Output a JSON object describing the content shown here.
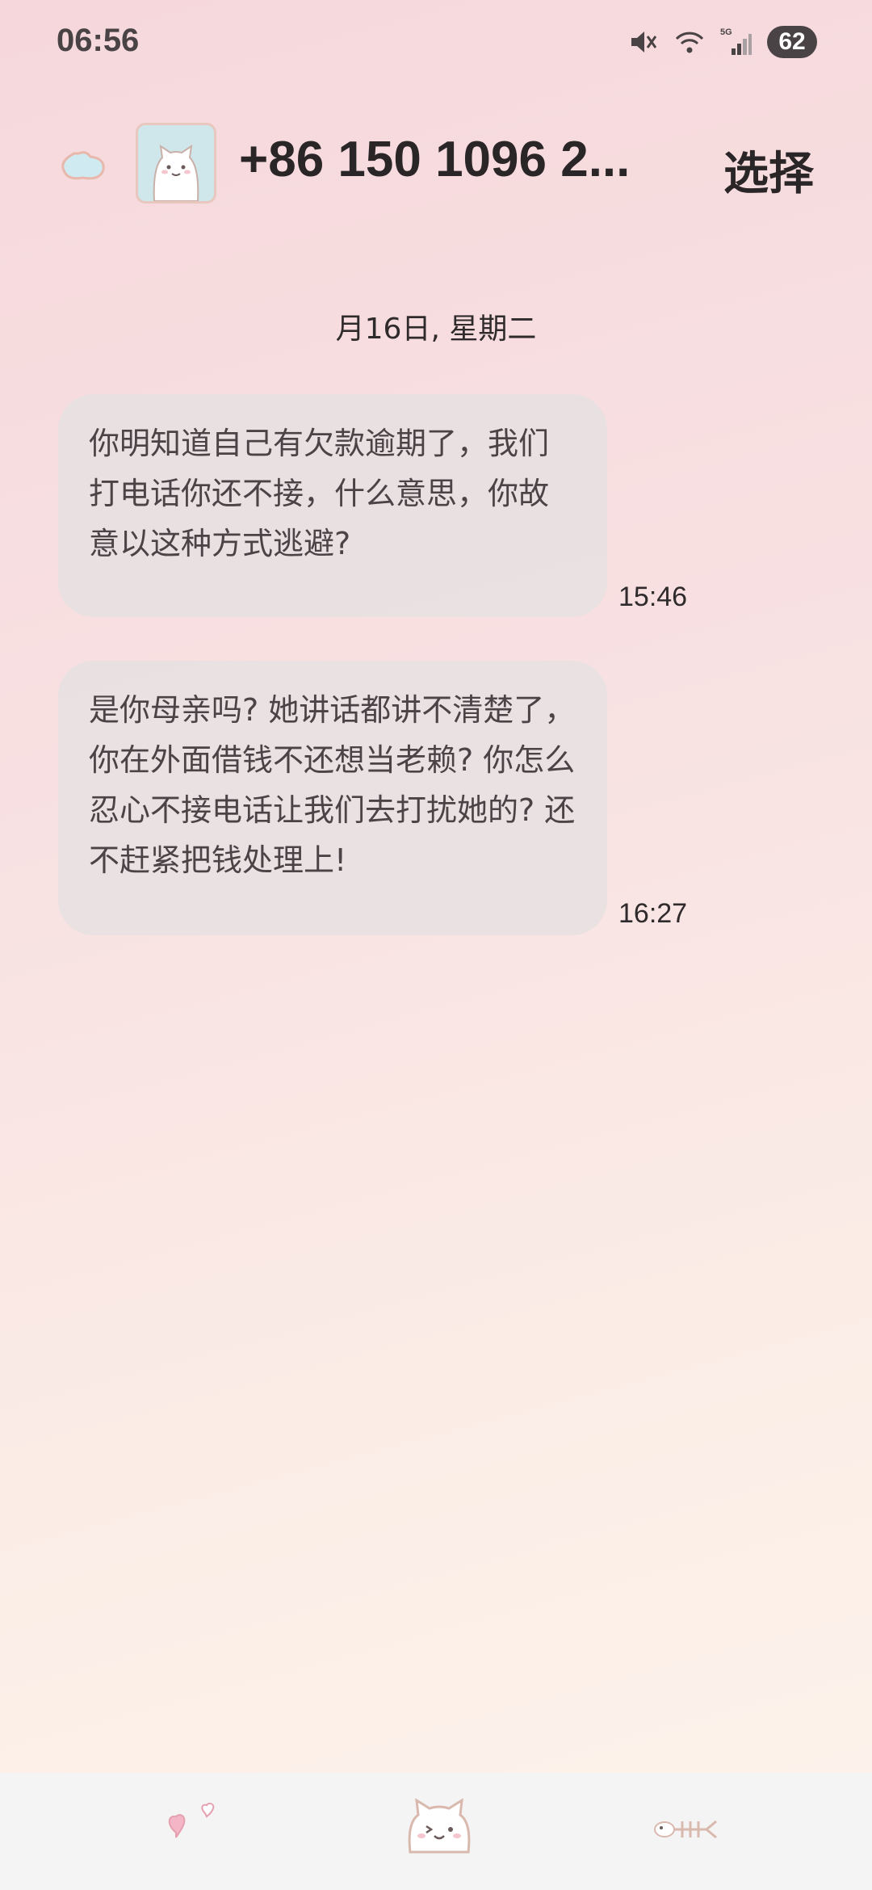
{
  "status": {
    "time": "06:56",
    "battery": "62",
    "network": "5G"
  },
  "header": {
    "contact": "+86 150 1096 2...",
    "select_label": "选择"
  },
  "conversation": {
    "date_label": "月16日, 星期二",
    "messages": [
      {
        "text": "你明知道自己有欠款逾期了，我们打电话你还不接，什么意思，你故意以这种方式逃避?",
        "time": "15:46"
      },
      {
        "text": "是你母亲吗? 她讲话都讲不清楚了，你在外面借钱不还想当老赖? 你怎么忍心不接电话让我们去打扰她的? 还不赶紧把钱处理上!",
        "time": "16:27"
      }
    ]
  },
  "colors": {
    "bubble": "#e6e0e2",
    "text": "#4b4346",
    "accent_pink": "#f2a6b9"
  }
}
